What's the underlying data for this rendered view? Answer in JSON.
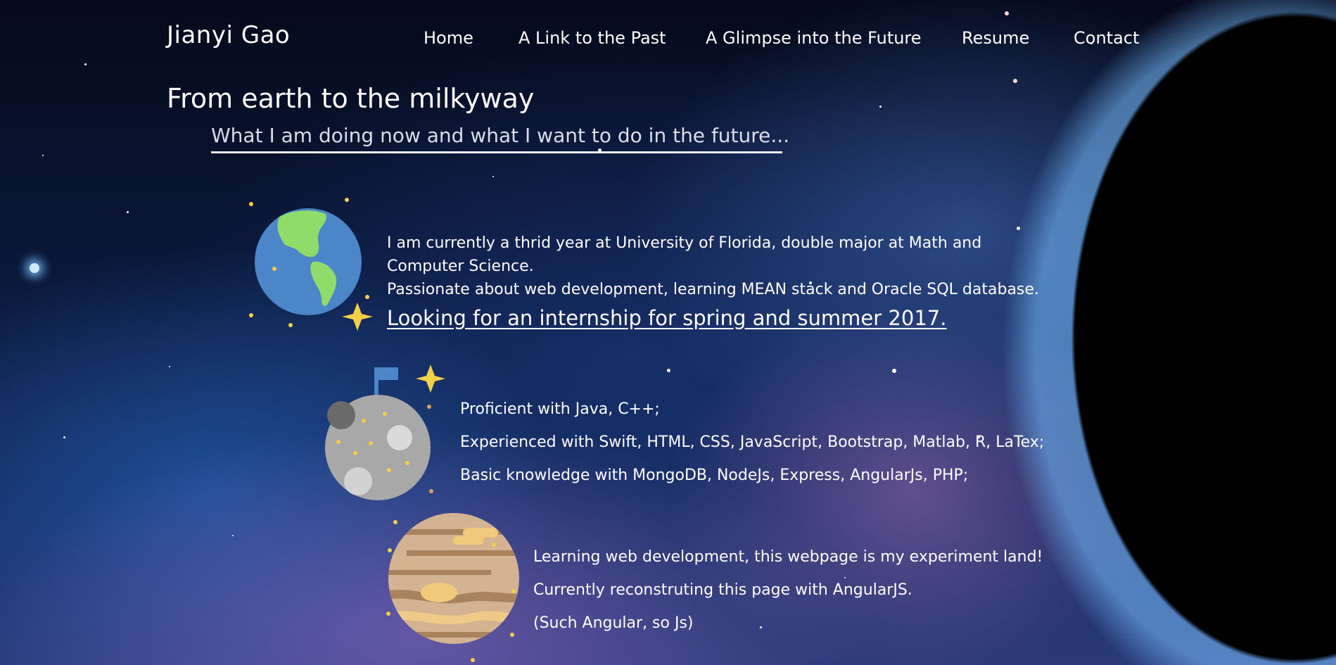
{
  "navbar": {
    "brand": "Jianyi Gao",
    "links": [
      {
        "label": "Home"
      },
      {
        "label": "A Link to the Past"
      },
      {
        "label": "A Glimpse into the Future"
      },
      {
        "label": "Resume"
      },
      {
        "label": "Contact"
      }
    ]
  },
  "hero": {
    "title": "From earth to the milkyway",
    "subtitle": "What I am doing now and what I want to do in the future..."
  },
  "sections": {
    "earth": {
      "icon": "earth-icon",
      "lines": [
        "I am currently a thrid year at University of Florida, double major at Math and",
        "Computer Science.",
        "Passionate about web development, learning MEAN stack and Oracle SQL database."
      ],
      "link": "Looking for an internship for spring and summer 2017."
    },
    "moon": {
      "icon": "moon-flag-icon",
      "lines": [
        "Proficient with Java, C++;",
        "Experienced with Swift, HTML, CSS, JavaScript, Bootstrap, Matlab, R, LaTex;",
        "Basic knowledge with MongoDB, NodeJs, Express, AngularJs, PHP;"
      ]
    },
    "jupiter": {
      "icon": "jupiter-icon",
      "lines": [
        "Learning web development, this webpage is my experiment land!",
        "Currently reconstruting this page with AngularJS.",
        "(Such Angular, so Js)"
      ]
    }
  },
  "colors": {
    "ocean": "#4a86c8",
    "land": "#8fdc6a",
    "sparkle": "#f5cf48",
    "moon": "#a8a8a8",
    "jupiter": "#d4b392"
  }
}
